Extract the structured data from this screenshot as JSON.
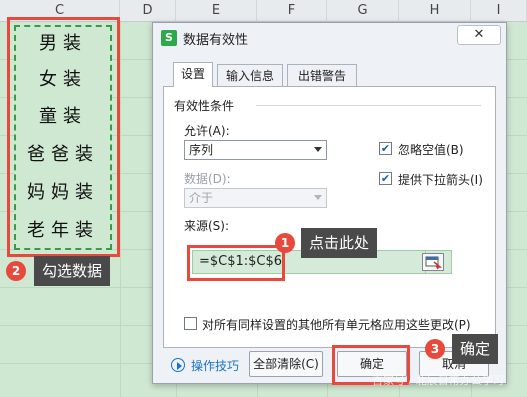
{
  "sheet": {
    "columns": [
      "C",
      "D",
      "E",
      "F",
      "G",
      "H",
      "I"
    ],
    "cells": [
      "男装",
      "女装",
      "童装",
      "爸爸装",
      "妈妈装",
      "老年装"
    ]
  },
  "callouts": {
    "c1": {
      "num": "1",
      "text": "点击此处"
    },
    "c2": {
      "num": "2",
      "text": "勾选数据"
    },
    "c3": {
      "num": "3",
      "text": "确定"
    }
  },
  "dialog": {
    "app_icon": "S",
    "title": "数据有效性",
    "close": "✕",
    "tabs": [
      "设置",
      "输入信息",
      "出错警告"
    ],
    "section_title": "有效性条件",
    "allow_label": "允许(A):",
    "allow_value": "序列",
    "data_label": "数据(D):",
    "data_value": "介于",
    "ignore_blank": "忽略空值(B)",
    "dropdown_arrow": "提供下拉箭头(I)",
    "source_label": "来源(S):",
    "source_value": "=$C$1:$C$6",
    "apply_all": "对所有同样设置的其他所有单元格应用这些更改(P)",
    "tips_link": "操作技巧",
    "clear_button": "全部清除(C)",
    "ok_button": "确定",
    "cancel_button": "取消"
  },
  "watermark": "百家号 / 北辰日常办公学习"
}
